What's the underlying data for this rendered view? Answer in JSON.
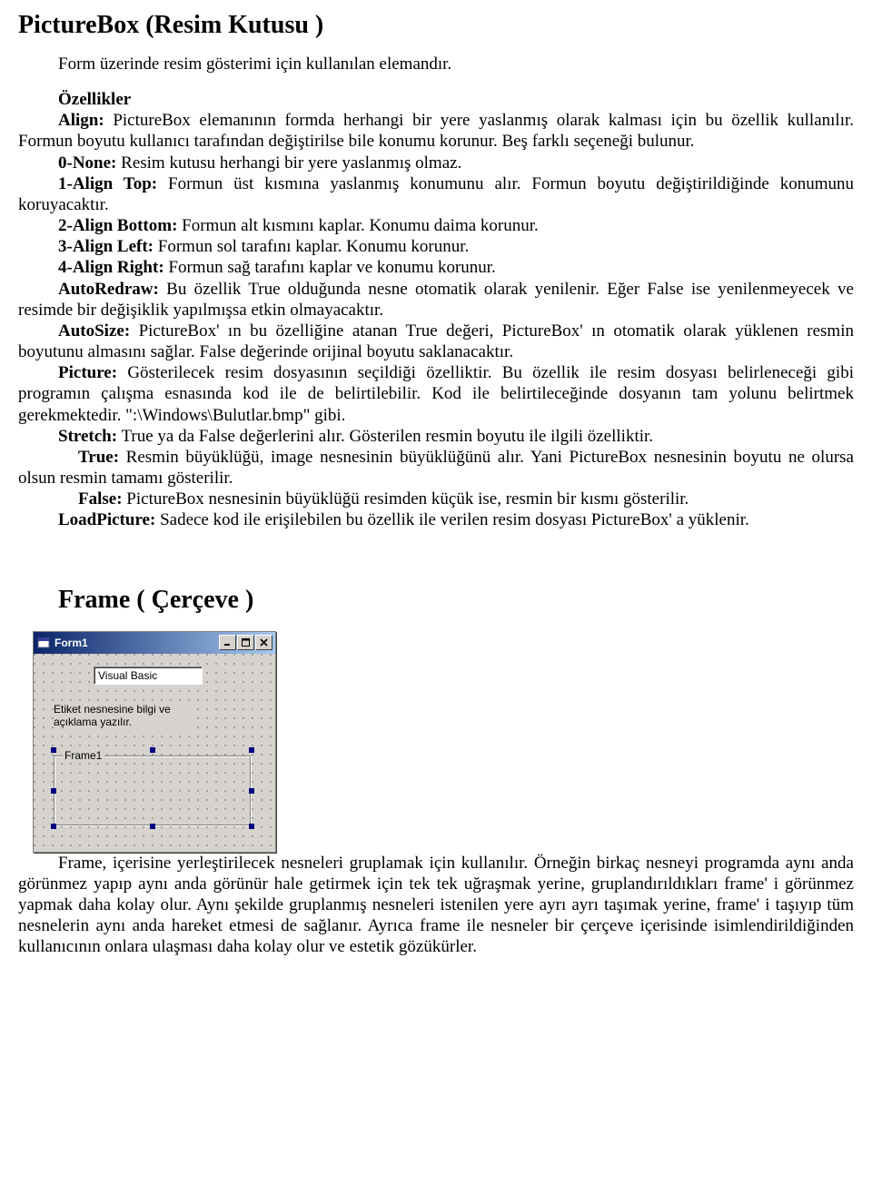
{
  "section1": {
    "title": "PictureBox (Resim Kutusu )",
    "intro": "Form üzerinde resim gösterimi için kullanılan elemandır.",
    "props_heading": "Özellikler",
    "align_label": "Align:",
    "align_text": " PictureBox elemanının formda herhangi bir yere yaslanmış olarak  kalması için bu özellik kullanılır. Formun boyutu kullanıcı tarafından değiştirilse bile konumu korunur. Beş farklı seçeneği bulunur.",
    "opt0_label": "0-None:",
    "opt0_text": " Resim kutusu herhangi bir yere yaslanmış olmaz.",
    "opt1_label": "1-Align Top:",
    "opt1_text": " Formun üst kısmına yaslanmış konumunu alır. Formun boyutu değiştirildiğinde konumunu koruyacaktır.",
    "opt2_label": "2-Align Bottom:",
    "opt2_text": " Formun alt kısmını kaplar. Konumu daima korunur.",
    "opt3_label": "3-Align Left:",
    "opt3_text": " Formun sol tarafını kaplar. Konumu korunur.",
    "opt4_label": "4-Align Right:",
    "opt4_text": " Formun sağ tarafını kaplar ve konumu korunur.",
    "autoredraw_label": "AutoRedraw:",
    "autoredraw_text": " Bu özellik True olduğunda nesne otomatik olarak yenilenir. Eğer False ise yenilenmeyecek ve resimde bir değişiklik yapılmışsa etkin olmayacaktır.",
    "autosize_label": "AutoSize:",
    "autosize_text": " PictureBox' ın bu özelliğine atanan True değeri, PictureBox' ın otomatik olarak yüklenen resmin boyutunu almasını sağlar. False değerinde orijinal  boyutu saklanacaktır.",
    "picture_label": "Picture:",
    "picture_text": " Gösterilecek resim dosyasının seçildiği özelliktir. Bu özellik ile resim dosyası belirleneceği gibi programın çalışma esnasında kod ile de belirtilebilir. Kod ile belirtileceğinde dosyanın tam yolunu belirtmek gerekmektedir. \":\\Windows\\Bulutlar.bmp\" gibi.",
    "stretch_label": "Stretch:",
    "stretch_text": " True ya da False değerlerini alır. Gösterilen resmin boyutu ile ilgili özelliktir.",
    "true_label": "True:",
    "true_text": " Resmin büyüklüğü, image nesnesinin büyüklüğünü alır. Yani PictureBox nesnesinin boyutu ne olursa  olsun resmin tamamı gösterilir.",
    "false_label": "False:",
    "false_text": " PictureBox nesnesinin büyüklüğü resimden küçük ise, resmin bir kısmı gösterilir.",
    "loadpic_label": "LoadPicture:",
    "loadpic_text": " Sadece kod ile erişilebilen bu özellik ile verilen resim dosyası PictureBox' a yüklenir."
  },
  "section2": {
    "title": "Frame ( Çerçeve )",
    "window_title": "Form1",
    "textbox_value": "Visual Basic",
    "label_text": "Etiket nesnesine bilgi ve açıklama yazılır.",
    "frame_caption": "Frame1",
    "para": "Frame, içerisine yerleştirilecek nesneleri gruplamak için kullanılır. Örneğin birkaç nesneyi programda aynı anda görünmez yapıp aynı anda görünür hale getirmek için tek tek uğraşmak yerine, gruplandırıldıkları frame' i görünmez yapmak daha kolay olur. Aynı şekilde gruplanmış nesneleri istenilen yere ayrı ayrı taşımak yerine, frame' i taşıyıp tüm nesnelerin aynı anda hareket etmesi de sağlanır. Ayrıca frame ile nesneler bir çerçeve içerisinde isimlendirildiğinden kullanıcının onlara ulaşması daha kolay olur ve estetik gözükürler."
  }
}
